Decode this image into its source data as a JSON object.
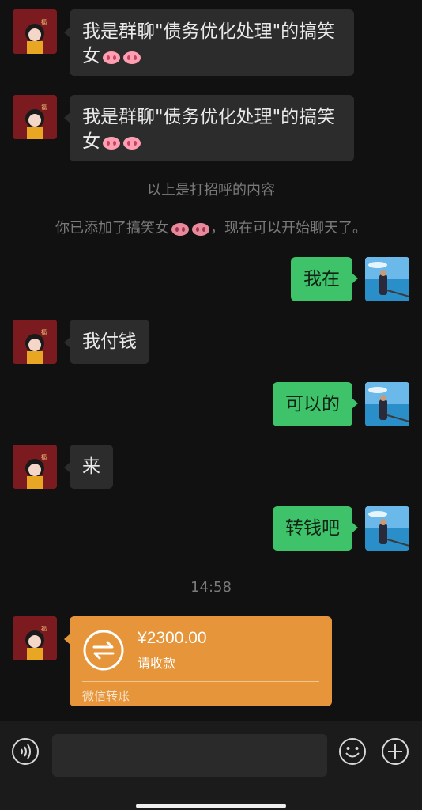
{
  "messages": [
    {
      "from": "other",
      "text": "我是群聊\"债务优化处理\"的搞笑",
      "text2": "女"
    },
    {
      "from": "other",
      "text": "我是群聊\"债务优化处理\"的搞笑",
      "text2": "女"
    },
    {
      "from": "system",
      "text": "以上是打招呼的内容"
    },
    {
      "from": "system",
      "text_before": "你已添加了搞笑女",
      "text_after": "，现在可以开始聊天了。"
    },
    {
      "from": "me",
      "text": "我在"
    },
    {
      "from": "other",
      "text": "我付钱"
    },
    {
      "from": "me",
      "text": "可以的"
    },
    {
      "from": "other",
      "text": "来"
    },
    {
      "from": "me",
      "text": "转钱吧"
    },
    {
      "from": "time",
      "text": "14:58"
    },
    {
      "from": "other",
      "type": "transfer",
      "amount": "¥2300.00",
      "status": "请收款",
      "footer": "微信转账"
    }
  ],
  "colors": {
    "background": "#111111",
    "incoming_bubble": "#2c2c2c",
    "outgoing_bubble": "#3fc36a",
    "transfer_card": "#e6953a"
  },
  "icons": {
    "voice": "voice-icon",
    "emoji": "emoji-icon",
    "plus": "plus-icon",
    "transfer": "transfer-arrows-icon"
  }
}
